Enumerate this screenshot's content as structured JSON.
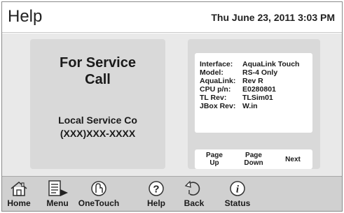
{
  "header": {
    "title": "Help",
    "datetime": "Thu June 23, 2011  3:03 PM"
  },
  "service": {
    "heading": "For Service\nCall",
    "company": "Local Service Co\n(XXX)XXX-XXXX"
  },
  "info": {
    "rows": [
      {
        "label": "Interface:",
        "value": "AquaLink Touch"
      },
      {
        "label": "Model:",
        "value": "RS-4 Only"
      },
      {
        "label": "AquaLink:",
        "value": "Rev R"
      },
      {
        "label": "CPU p/n:",
        "value": "E0280801"
      },
      {
        "label": "TL Rev:",
        "value": "TLSim01"
      },
      {
        "label": "JBox Rev:",
        "value": "W.in"
      }
    ]
  },
  "pager": {
    "page_up": "Page\nUp",
    "page_down": "Page\nDown",
    "next": "Next"
  },
  "nav": {
    "items": [
      {
        "label": "Home",
        "icon": "home-icon"
      },
      {
        "label": "Menu",
        "icon": "menu-icon"
      },
      {
        "label": "OneTouch",
        "icon": "onetouch-icon"
      },
      {
        "label": "Help",
        "icon": "help-icon"
      },
      {
        "label": "Back",
        "icon": "back-icon"
      },
      {
        "label": "Status",
        "icon": "status-icon"
      }
    ]
  }
}
